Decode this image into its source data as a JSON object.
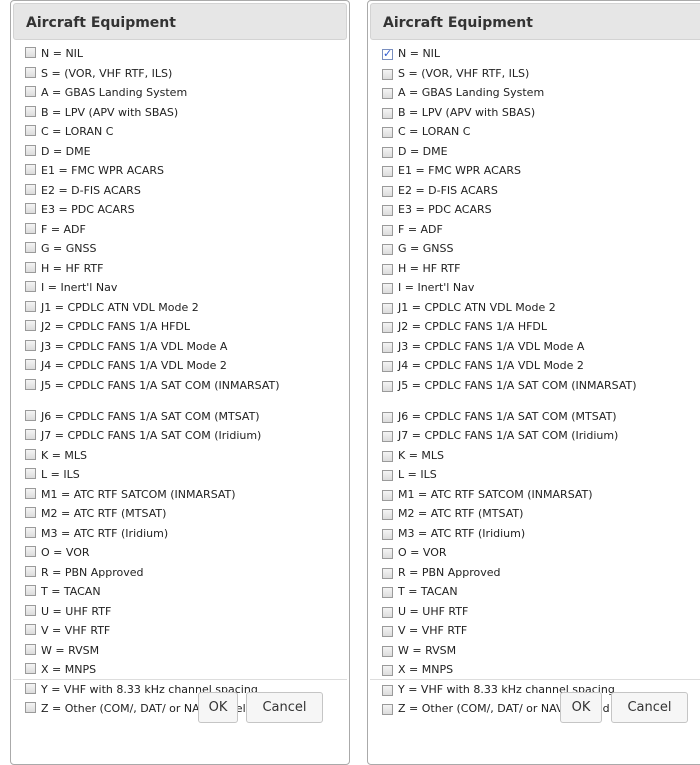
{
  "dialogs": [
    {
      "title": "Aircraft Equipment",
      "ok_label": "OK",
      "cancel_label": "Cancel",
      "checked": []
    },
    {
      "title": "Aircraft Equipment",
      "ok_label": "OK",
      "cancel_label": "Cancel",
      "checked": [
        "N = NIL"
      ]
    }
  ],
  "equipment_items": [
    "N = NIL",
    "S = (VOR, VHF RTF, ILS)",
    "A = GBAS Landing System",
    "B = LPV (APV with SBAS)",
    "C = LORAN C",
    "D = DME",
    "E1 = FMC WPR ACARS",
    "E2 = D-FIS ACARS",
    "E3 = PDC ACARS",
    "F = ADF",
    "G = GNSS",
    "H = HF RTF",
    "I = Inert'l Nav",
    "J1 = CPDLC ATN VDL Mode 2",
    "J2 = CPDLC FANS 1/A HFDL",
    "J3 = CPDLC FANS 1/A VDL Mode A",
    "J4 = CPDLC FANS 1/A VDL Mode 2",
    "J5 = CPDLC FANS 1/A SAT COM (INMARSAT)",
    "J6 = CPDLC FANS 1/A SAT COM (MTSAT)",
    "J7 = CPDLC FANS 1/A SAT COM (Iridium)",
    "K = MLS",
    "L = ILS",
    "M1 = ATC RTF SATCOM (INMARSAT)",
    "M2 = ATC RTF (MTSAT)",
    "M3 = ATC RTF (Iridium)",
    "O = VOR",
    "R = PBN Approved",
    "T = TACAN",
    "U = UHF RTF",
    "V = VHF RTF",
    "W = RVSM",
    "X = MNPS",
    "Y = VHF with 8.33 kHz channel spacing",
    "Z = Other (COM/, DAT/ or NAV/ in Field 18)"
  ]
}
